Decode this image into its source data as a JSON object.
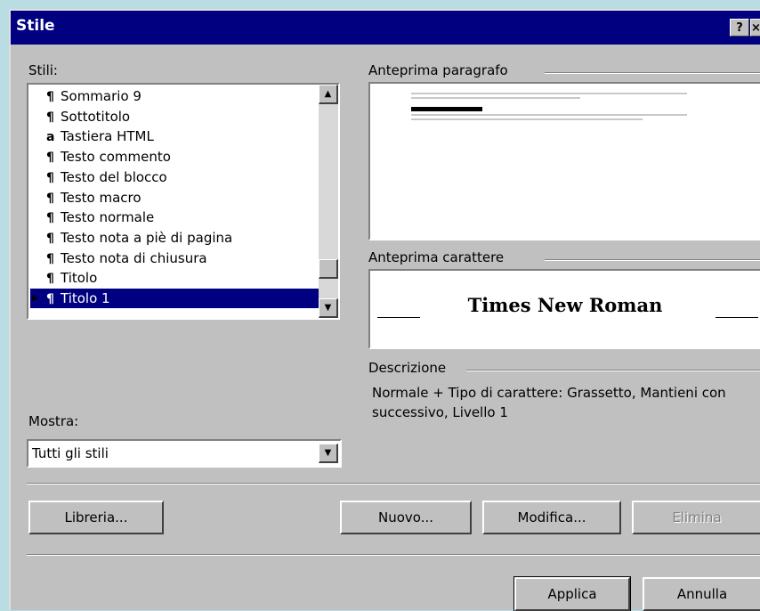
{
  "window": {
    "title": "Stile",
    "help_label": "?",
    "close_label": "×"
  },
  "styles_list": {
    "label": "Stili:",
    "items": [
      {
        "label": "Sommario 9",
        "mark": "¶"
      },
      {
        "label": "Sottotitolo",
        "mark": "¶"
      },
      {
        "label": "Tastiera HTML",
        "mark": "a"
      },
      {
        "label": "Testo commento",
        "mark": "¶"
      },
      {
        "label": "Testo del blocco",
        "mark": "¶"
      },
      {
        "label": "Testo macro",
        "mark": "¶"
      },
      {
        "label": "Testo normale",
        "mark": "¶"
      },
      {
        "label": "Testo nota a piè di pagina",
        "mark": "¶"
      },
      {
        "label": "Testo nota di chiusura",
        "mark": "¶"
      },
      {
        "label": "Titolo",
        "mark": "¶"
      },
      {
        "label": "Titolo 1",
        "mark": "¶",
        "selected": true
      }
    ]
  },
  "paragraph_preview": {
    "label": "Anteprima paragrafo"
  },
  "character_preview": {
    "label": "Anteprima carattere",
    "font_name": "Times New Roman"
  },
  "description": {
    "label": "Descrizione",
    "text": "Normale + Tipo di carattere: Grassetto, Mantieni con successivo, Livello 1"
  },
  "show": {
    "label": "Mostra:",
    "selected": "Tutti gli stili"
  },
  "buttons": {
    "library": "Libreria...",
    "new": "Nuovo...",
    "modify": "Modifica...",
    "delete": "Elimina",
    "apply": "Applica",
    "cancel": "Annulla"
  },
  "colors": {
    "title_bar": "#000080",
    "dialog_face": "#c0c0c0",
    "selection": "#000080"
  }
}
